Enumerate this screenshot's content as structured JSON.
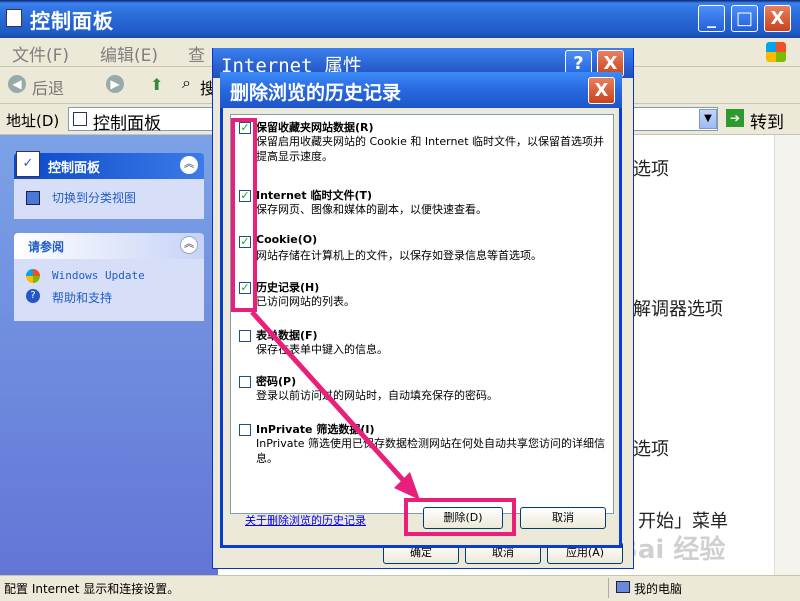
{
  "window": {
    "title": "控制面板",
    "min": "_",
    "max": "□",
    "close": "X"
  },
  "menu": {
    "file": "文件(F)",
    "edit": "编辑(E)",
    "view": "查"
  },
  "toolbar": {
    "back": "后退",
    "search_fragment": "搜"
  },
  "address": {
    "label": "地址(D)",
    "value": "控制面板",
    "go": "转到"
  },
  "taskpane": {
    "panel1_title": "控制面板",
    "panel1_link": "切换到分类视图",
    "panel2_title": "请参阅",
    "panel2_links": [
      "Windows Update",
      "帮助和支持"
    ]
  },
  "background_items": [
    "选项",
    "解调器选项",
    "选项",
    "开始」菜单"
  ],
  "statusbar": {
    "text": "配置 Internet 显示和连接设置。",
    "zone": "我的电脑"
  },
  "watermark": "Bai 经验",
  "dialog_back": {
    "title": "Internet 属性",
    "help": "?",
    "close": "X",
    "buttons": {
      "ok": "确定",
      "cancel": "取消",
      "apply": "应用(A)"
    }
  },
  "dialog": {
    "title": "删除浏览的历史记录",
    "close": "X",
    "options": [
      {
        "title": "保留收藏夹网站数据(R)",
        "desc": "保留启用收藏夹网站的 Cookie 和 Internet 临时文件，以保留首选项并提高显示速度。",
        "checked": true
      },
      {
        "title": "Internet 临时文件(T)",
        "desc": "保存网页、图像和媒体的副本，以便快速查看。",
        "checked": true
      },
      {
        "title": "Cookie(O)",
        "desc": "网站存储在计算机上的文件，以保存如登录信息等首选项。",
        "checked": true
      },
      {
        "title": "历史记录(H)",
        "desc": "已访问网站的列表。",
        "checked": true
      },
      {
        "title": "表单数据(F)",
        "desc": "保存在表单中键入的信息。",
        "checked": false
      },
      {
        "title": "密码(P)",
        "desc": "登录以前访问过的网站时，自动填充保存的密码。",
        "checked": false
      },
      {
        "title": "InPrivate 筛选数据(I)",
        "desc": "InPrivate 筛选使用已保存数据检测网站在何处自动共享您访问的详细信息。",
        "checked": false
      }
    ],
    "link": "关于删除浏览的历史记录",
    "delete": "删除(D)",
    "cancel": "取消"
  },
  "colors": {
    "highlight": "#e8207a",
    "titlebar": "#2a6cd8"
  }
}
